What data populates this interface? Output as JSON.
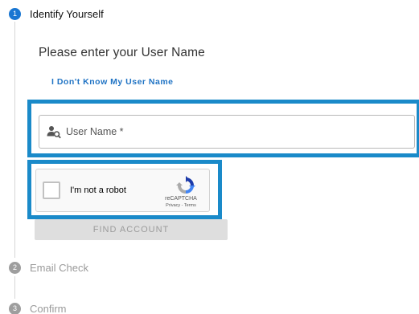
{
  "steps": [
    {
      "number": "1",
      "label": "Identify Yourself",
      "color": "#1976d2"
    },
    {
      "number": "2",
      "label": "Email Check",
      "color": "#9e9e9e"
    },
    {
      "number": "3",
      "label": "Confirm",
      "color": "#9e9e9e"
    }
  ],
  "form": {
    "heading": "Please enter your User Name",
    "forgot_link": "I Don't Know My User Name",
    "username_label": "User Name *",
    "username_icon": "user-search-icon",
    "find_button": "FIND ACCOUNT"
  },
  "recaptcha": {
    "checkbox_label": "I'm not a robot",
    "brand": "reCAPTCHA",
    "terms": "Privacy - Terms"
  },
  "colors": {
    "accent": "#1976d2",
    "link": "#1f73c4",
    "highlight": "#1a8ac9",
    "disabled_button": "#dedede"
  }
}
